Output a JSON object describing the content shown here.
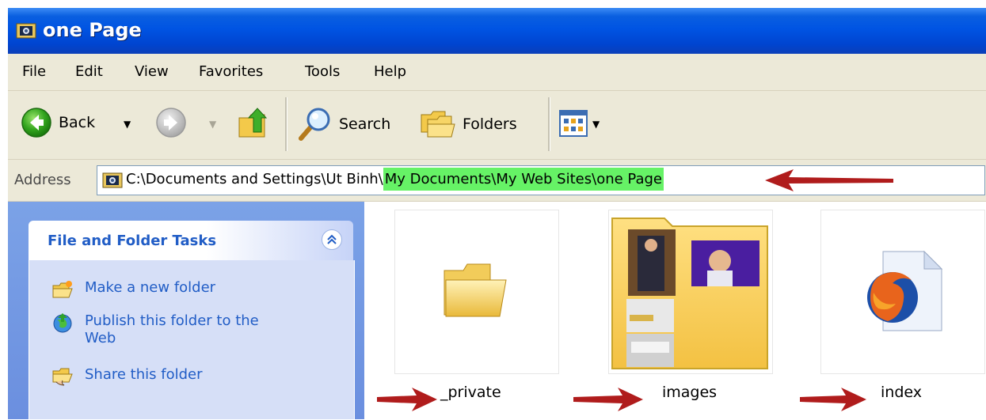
{
  "window": {
    "title": "one Page"
  },
  "menu": [
    "File",
    "Edit",
    "View",
    "Favorites",
    "Tools",
    "Help"
  ],
  "toolbar": {
    "back_label": "Back",
    "search_label": "Search",
    "folders_label": "Folders"
  },
  "address": {
    "label": "Address",
    "path_prefix": "C:\\Documents and Settings\\Ut Binh\\",
    "path_highlight": "My Documents\\My Web Sites\\one Page"
  },
  "tasks": {
    "title": "File and Folder Tasks",
    "items": [
      {
        "label": "Make a new folder",
        "icon": "new-folder-icon"
      },
      {
        "label": "Publish this folder to the Web",
        "icon": "publish-web-icon"
      },
      {
        "label": "Share this folder",
        "icon": "share-folder-icon"
      }
    ]
  },
  "files": [
    {
      "name": "_private",
      "icon": "folder-icon"
    },
    {
      "name": "images",
      "icon": "folder-thumbnail-icon"
    },
    {
      "name": "index",
      "icon": "firefox-html-file-icon"
    }
  ],
  "colors": {
    "title_bar": "#0054e3",
    "highlight": "#66f266",
    "annotation_arrow": "#b01c1c",
    "task_link": "#215dc6"
  }
}
